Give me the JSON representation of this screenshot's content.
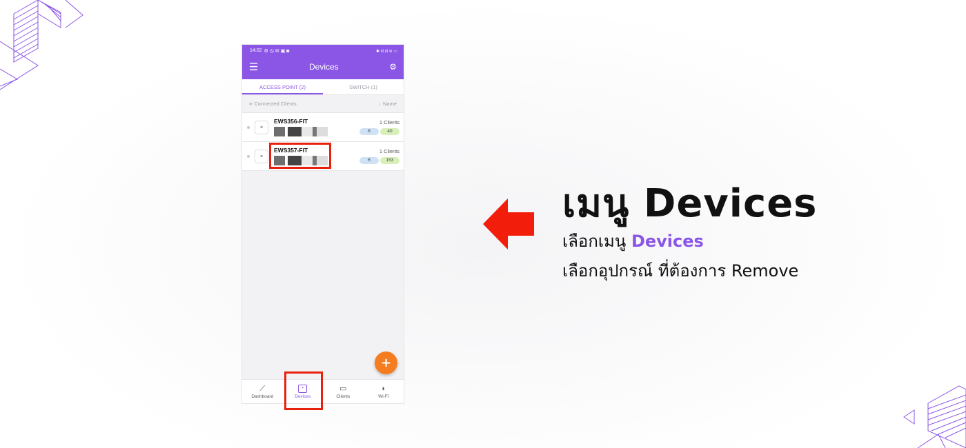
{
  "phone": {
    "status_time": "14:02",
    "status_left_icons": "⚙ ◷ ✉ ▣ ◙",
    "status_right_icons": "✱ ıll ıll ≋ ▭",
    "title": "Devices",
    "tabs": [
      "ACCESS POINT (2)",
      "SWITCH (1)"
    ],
    "filter_label": "Connected Clients",
    "sort_label": "Name",
    "devices": [
      {
        "name": "EWS356-FIT",
        "clients": "1 Clients",
        "badge_blue": "6",
        "badge_green": "40"
      },
      {
        "name": "EWS357-FIT",
        "clients": "1 Clients",
        "badge_blue": "6",
        "badge_green": "153"
      }
    ],
    "fab_label": "+",
    "nav": [
      "Dashboard",
      "Devices",
      "Clients",
      "Wi-Fi"
    ]
  },
  "text": {
    "headline": "เมนู Devices",
    "line1_prefix": "เลือกเมนู",
    "line1_accent": "Devices",
    "line2": "เลือกอุปกรณ์ ที่ต้องการ Remove"
  },
  "colors": {
    "accent": "#8b55e6",
    "highlight": "#e8210e",
    "fab": "#f57c1f"
  },
  "icons": {
    "menu": "hamburger-icon",
    "settings": "gear-icon",
    "arrow": "red-left-arrow"
  }
}
